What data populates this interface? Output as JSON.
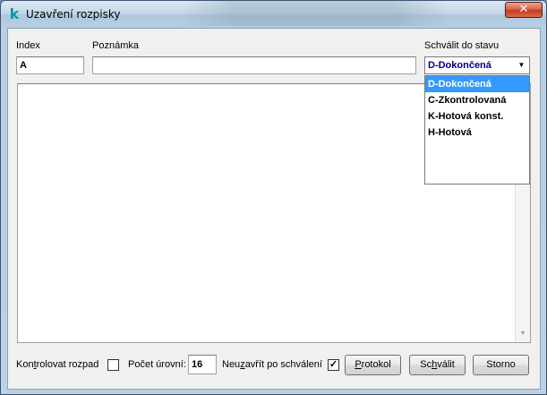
{
  "window": {
    "title": "Uzavření rozpisky",
    "close_glyph": "✕",
    "icon": "app-k-icon"
  },
  "form": {
    "index_label": "Index",
    "index_value": "A",
    "note_label": "Poznámka",
    "note_value": "",
    "approve_state_label": "Schválit do stavu",
    "approve_state_value": "D-Dokončená",
    "approve_state_options": [
      "D-Dokončená",
      "C-Zkontrolovaná",
      "K-Hotová konst.",
      "H-Hotová"
    ]
  },
  "footer": {
    "check_breakdown_label_pre": "Kon",
    "check_breakdown_label_u": "t",
    "check_breakdown_label_post": "rolovat rozpad",
    "check_breakdown_checked": false,
    "levels_label": "Počet úrovní:",
    "levels_value": "16",
    "no_close_label_pre": "Neu",
    "no_close_label_u": "z",
    "no_close_label_post": "avřít po schválení",
    "no_close_checked": true,
    "check_glyph": "✓",
    "protocol_u": "P",
    "protocol_rest": "rotokol",
    "approve_pre": "Sc",
    "approve_u": "h",
    "approve_post": "válit",
    "cancel_label": "Storno"
  }
}
